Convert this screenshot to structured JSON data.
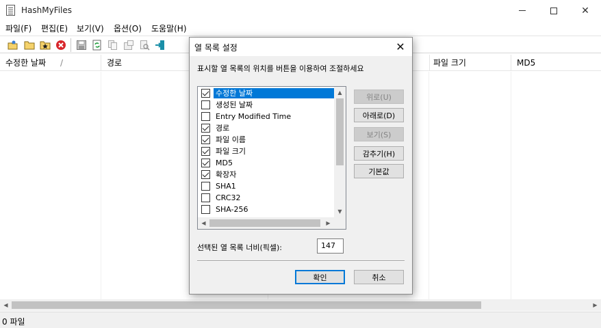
{
  "window": {
    "title": "HashMyFiles"
  },
  "menu": [
    "파일(F)",
    "편집(E)",
    "보기(V)",
    "옵션(O)",
    "도움말(H)"
  ],
  "toolbar": {
    "icons": [
      "open-file-icon",
      "open-folder-icon",
      "add-favorite-icon",
      "stop-icon",
      "save-icon",
      "refresh-icon",
      "copy-icon",
      "properties-icon",
      "find-icon",
      "exit-icon"
    ]
  },
  "list": {
    "columns": [
      "수정한 날짜",
      "경로",
      "파일 크기",
      "MD5"
    ],
    "sort_indicator": "/"
  },
  "status": {
    "text": "0 파일"
  },
  "dialog": {
    "title": "열 목록 설정",
    "instructions": "표시할 열 목록의 위치를 버튼을 이용하여 조절하세요",
    "columns": [
      {
        "label": "수정한 날짜",
        "checked": true,
        "selected": true
      },
      {
        "label": "생성된 날짜",
        "checked": false
      },
      {
        "label": "Entry Modified Time",
        "checked": false
      },
      {
        "label": "경로",
        "checked": true
      },
      {
        "label": "파일 이름",
        "checked": true
      },
      {
        "label": "파일 크기",
        "checked": true
      },
      {
        "label": "MD5",
        "checked": true
      },
      {
        "label": "확장자",
        "checked": true
      },
      {
        "label": "SHA1",
        "checked": false
      },
      {
        "label": "CRC32",
        "checked": false
      },
      {
        "label": "SHA-256",
        "checked": false
      }
    ],
    "buttons": {
      "up": "위로(U)",
      "down": "아래로(D)",
      "show": "보기(S)",
      "hide": "감추기(H)",
      "default": "기본값"
    },
    "width_label": "선택된 열 목록 너비(픽셀):",
    "width_value": "147",
    "ok": "확인",
    "cancel": "취소"
  }
}
